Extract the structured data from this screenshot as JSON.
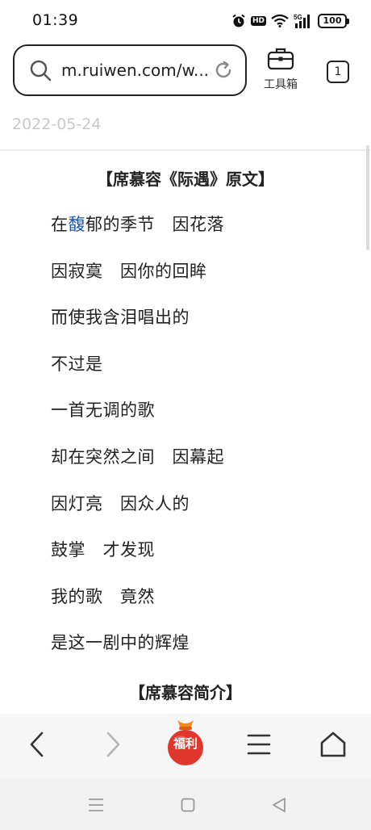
{
  "status_bar": {
    "time": "01:39",
    "battery": "100",
    "icons": [
      "alarm-icon",
      "hd-icon",
      "wifi-icon",
      "5g-signal-icon",
      "battery-icon"
    ],
    "hd_label": "HD"
  },
  "browser": {
    "url": "m.ruiwen.com/w...",
    "toolbox_label": "工具箱",
    "tab_count": "1"
  },
  "article": {
    "date": "2022-05-24",
    "section_title_1": "【席慕容《际遇》原文】",
    "poem": {
      "line1_pre": "在",
      "line1_link": "馥",
      "line1_post": "郁的季节　因花落",
      "lines": [
        "因寂寞　因你的回眸",
        "而使我含泪唱出的",
        "不过是",
        "一首无调的歌",
        "却在突然之间　因幕起",
        "因灯亮　因众人的",
        "鼓掌　才发现",
        "我的歌　竟然",
        "是这一剧中的辉煌"
      ]
    },
    "section_title_2": "【席慕容简介】"
  },
  "bottom_bar": {
    "fuli_label": "福利"
  },
  "colors": {
    "link": "#1e55b3",
    "date": "#c8c8c8",
    "fuli_red": "#e0362b"
  }
}
